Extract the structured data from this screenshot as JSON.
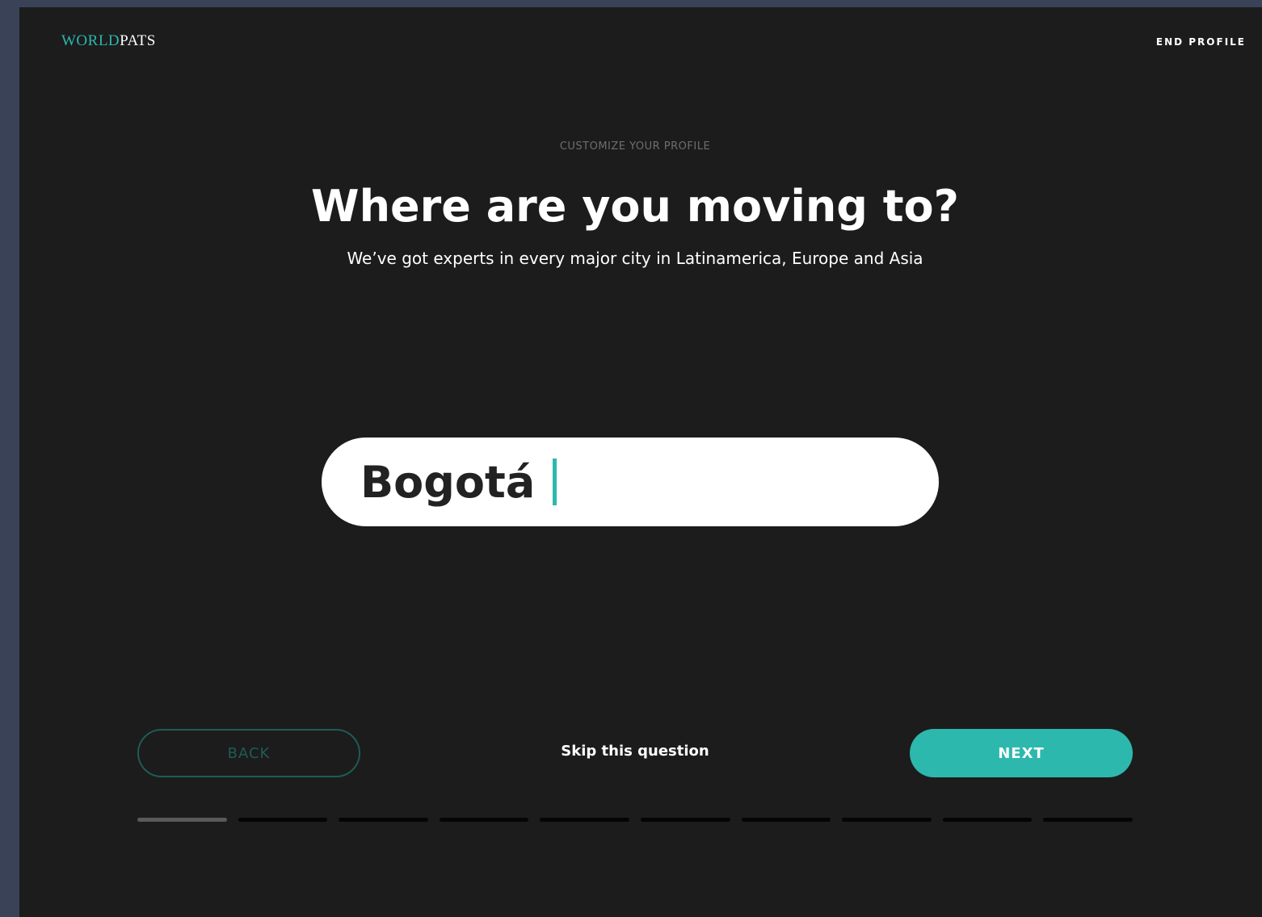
{
  "logo": {
    "part1": "WORLD",
    "part2": "PATS"
  },
  "header": {
    "end_profile": "END PROFILE"
  },
  "eyebrow": "CUSTOMIZE YOUR PROFILE",
  "title": "Where are you moving to?",
  "subtitle": "We’ve got experts in every major city in Latinamerica, Europe and Asia",
  "search": {
    "value": "Bogotá"
  },
  "buttons": {
    "back": "BACK",
    "skip": "Skip this question",
    "next": "NEXT"
  },
  "progress": {
    "current_step": 1,
    "total_steps": 10
  },
  "colors": {
    "accent": "#2db8ad",
    "background": "#1c1c1c"
  }
}
